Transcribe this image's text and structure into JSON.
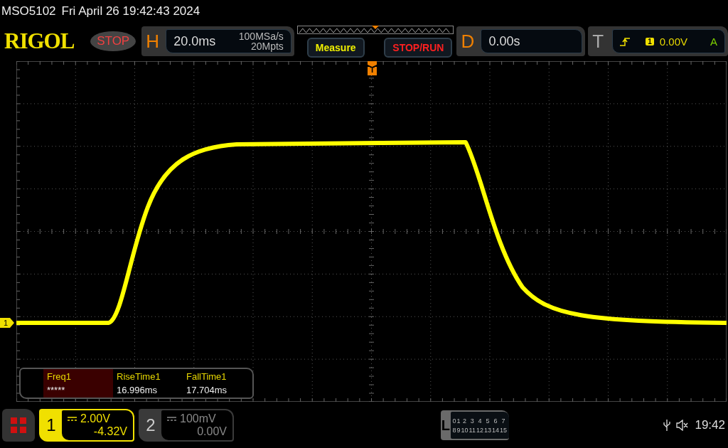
{
  "status_line": {
    "model": "MSO5102",
    "datetime": "Fri April 26 19:42:43 2024"
  },
  "header": {
    "logo": "RIGOL",
    "run_state": "STOP",
    "horizontal": {
      "label": "H",
      "timebase": "20.0ms",
      "sample_rate": "100MSa/s",
      "memory_depth": "20Mpts"
    },
    "buttons": [
      {
        "label": "Measure",
        "kind": "measure"
      },
      {
        "label": "STOP/RUN",
        "kind": "run"
      }
    ],
    "delay": {
      "label": "D",
      "value": "0.00s"
    },
    "trigger": {
      "label": "T",
      "source": "1",
      "level": "0.00V",
      "mode": "A"
    }
  },
  "display": {
    "channel_marker": "1",
    "trigger_marker": "T"
  },
  "measurements": [
    {
      "name": "Freq1",
      "value": "*****",
      "selected": true
    },
    {
      "name": "RiseTime1",
      "value": "16.996ms",
      "selected": false
    },
    {
      "name": "FallTime1",
      "value": "17.704ms",
      "selected": false
    }
  ],
  "channels": [
    {
      "number": "1",
      "scale": "2.00V",
      "offset": "-4.32V",
      "selected": true
    },
    {
      "number": "2",
      "scale": "100mV",
      "offset": "0.00V",
      "selected": false
    }
  ],
  "logic": {
    "label": "L",
    "rows": [
      [
        "0",
        "1",
        "2",
        "3",
        "4",
        "5",
        "6",
        "7"
      ],
      [
        "8",
        "9",
        "10",
        "11",
        "12",
        "13",
        "14",
        "15"
      ]
    ]
  },
  "status_tray": {
    "time": "19:42"
  }
}
